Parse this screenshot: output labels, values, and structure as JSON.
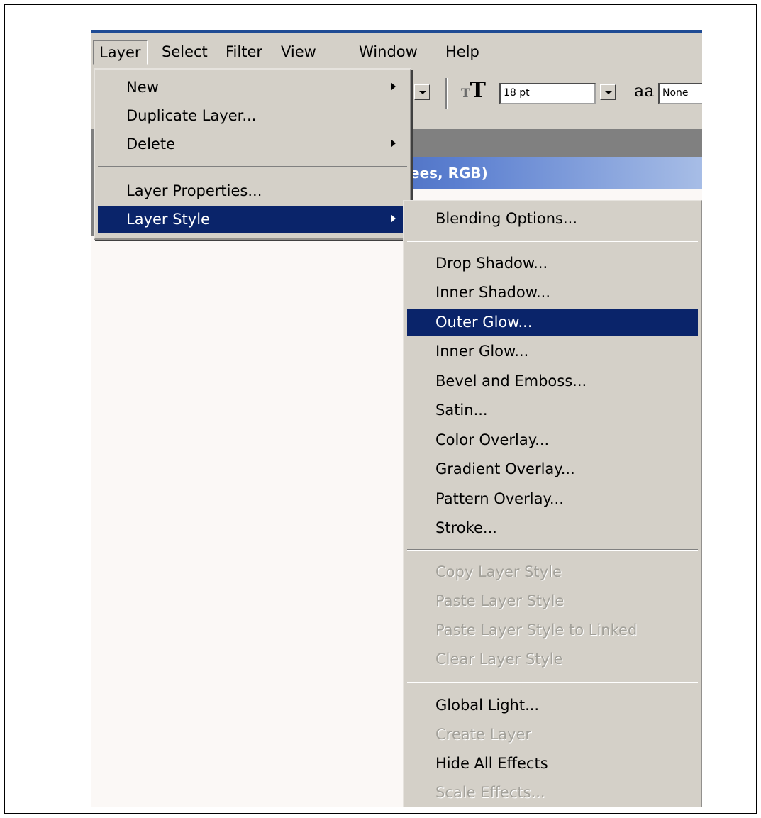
{
  "menubar": {
    "items": [
      "Layer",
      "Select",
      "Filter",
      "View",
      "Window",
      "Help"
    ]
  },
  "toolbar": {
    "font_size": "18 pt",
    "antialias": "None",
    "type_icon": "T",
    "aa_icon": "aa"
  },
  "document": {
    "title_fragment": "ees, RGB)"
  },
  "layer_menu": {
    "items": [
      {
        "label": "New",
        "submenu": true
      },
      {
        "label": "Duplicate Layer...",
        "submenu": false
      },
      {
        "label": "Delete",
        "submenu": true
      },
      {
        "label": "Layer Properties...",
        "submenu": false
      },
      {
        "label": "Layer Style",
        "submenu": true,
        "highlighted": true
      }
    ]
  },
  "layer_style_menu": {
    "items": [
      {
        "label": "Blending Options...",
        "enabled": true
      },
      {
        "label": "Drop Shadow...",
        "enabled": true
      },
      {
        "label": "Inner Shadow...",
        "enabled": true
      },
      {
        "label": "Outer Glow...",
        "enabled": true,
        "highlighted": true
      },
      {
        "label": "Inner Glow...",
        "enabled": true
      },
      {
        "label": "Bevel and Emboss...",
        "enabled": true
      },
      {
        "label": "Satin...",
        "enabled": true
      },
      {
        "label": "Color Overlay...",
        "enabled": true
      },
      {
        "label": "Gradient Overlay...",
        "enabled": true
      },
      {
        "label": "Pattern Overlay...",
        "enabled": true
      },
      {
        "label": "Stroke...",
        "enabled": true
      },
      {
        "label": "Copy Layer Style",
        "enabled": false
      },
      {
        "label": "Paste Layer Style",
        "enabled": false
      },
      {
        "label": "Paste Layer Style to Linked",
        "enabled": false
      },
      {
        "label": "Clear Layer Style",
        "enabled": false
      },
      {
        "label": "Global Light...",
        "enabled": true
      },
      {
        "label": "Create Layer",
        "enabled": false
      },
      {
        "label": "Hide All Effects",
        "enabled": true
      },
      {
        "label": "Scale Effects...",
        "enabled": false
      }
    ]
  },
  "colors": {
    "menu_bg": "#d4d0c8",
    "highlight": "#0a246a",
    "disabled_text": "#a3a19a",
    "title_bar": "#1f3b8b"
  }
}
